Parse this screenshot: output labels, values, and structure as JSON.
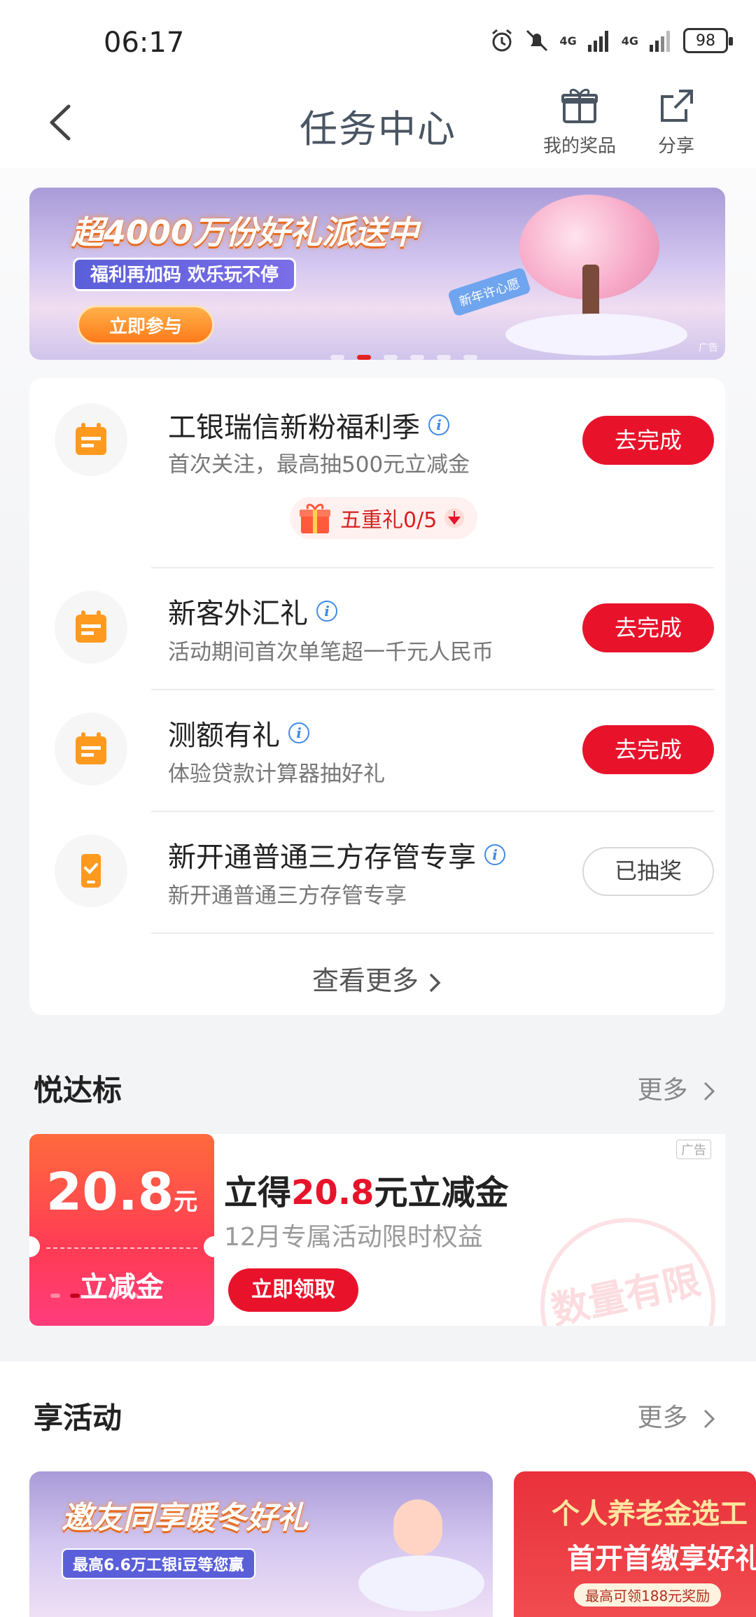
{
  "status_bar": {
    "time": "06:17",
    "battery": "98",
    "network1": "4G",
    "network2": "4G"
  },
  "header": {
    "title": "任务中心",
    "back_icon": "back-arrow-icon",
    "prizes_label": "我的奖品",
    "share_label": "分享"
  },
  "banner": {
    "headline": "超4000万份好礼派送中",
    "subtitle": "福利再加码 欢乐玩不停",
    "cta": "立即参与",
    "sign": "新年许心愿",
    "ad_tag": "广告",
    "active_dot": 2,
    "dot_count": 6
  },
  "tasks": [
    {
      "title": "工银瑞信新粉福利季",
      "desc": "首次关注，最高抽500元立减金",
      "button": "去完成",
      "status": "todo",
      "icon": "calendar-icon"
    },
    {
      "title": "新客外汇礼",
      "desc": "活动期间首次单笔超一千元人民币",
      "button": "去完成",
      "status": "todo",
      "icon": "calendar-icon"
    },
    {
      "title": "测额有礼",
      "desc": "体验贷款计算器抽好礼",
      "button": "去完成",
      "status": "todo",
      "icon": "calendar-icon"
    },
    {
      "title": "新开通普通三方存管专享",
      "desc": "新开通普通三方存管专享",
      "button": "已抽奖",
      "status": "done",
      "icon": "phone-check-icon"
    }
  ],
  "gift_pill": {
    "label": "五重礼0/5"
  },
  "view_more": "查看更多",
  "section1": {
    "title": "悦达标",
    "more": "更多",
    "coupon": {
      "amount": "20.8",
      "unit": "元",
      "label": "立减金",
      "title_prefix": "立得",
      "title_amount": "20.8",
      "title_suffix": "元立减金",
      "subtitle": "12月专属活动限时权益",
      "button": "立即领取",
      "ad_tag": "广告",
      "stamp": "数量有限"
    }
  },
  "section2": {
    "title": "享活动",
    "more": "更多",
    "cards": [
      {
        "title": "邀友同享暖冬好礼",
        "sub": "最高6.6万工银i豆等您赢"
      },
      {
        "title": "个人养老金选工",
        "title2": "首开首缴享好礼",
        "sub": "最高可领188元奖励"
      }
    ]
  },
  "colors": {
    "accent": "#e8132b",
    "icon_orange": "#ff9a1f",
    "info_blue": "#3e8be6"
  }
}
